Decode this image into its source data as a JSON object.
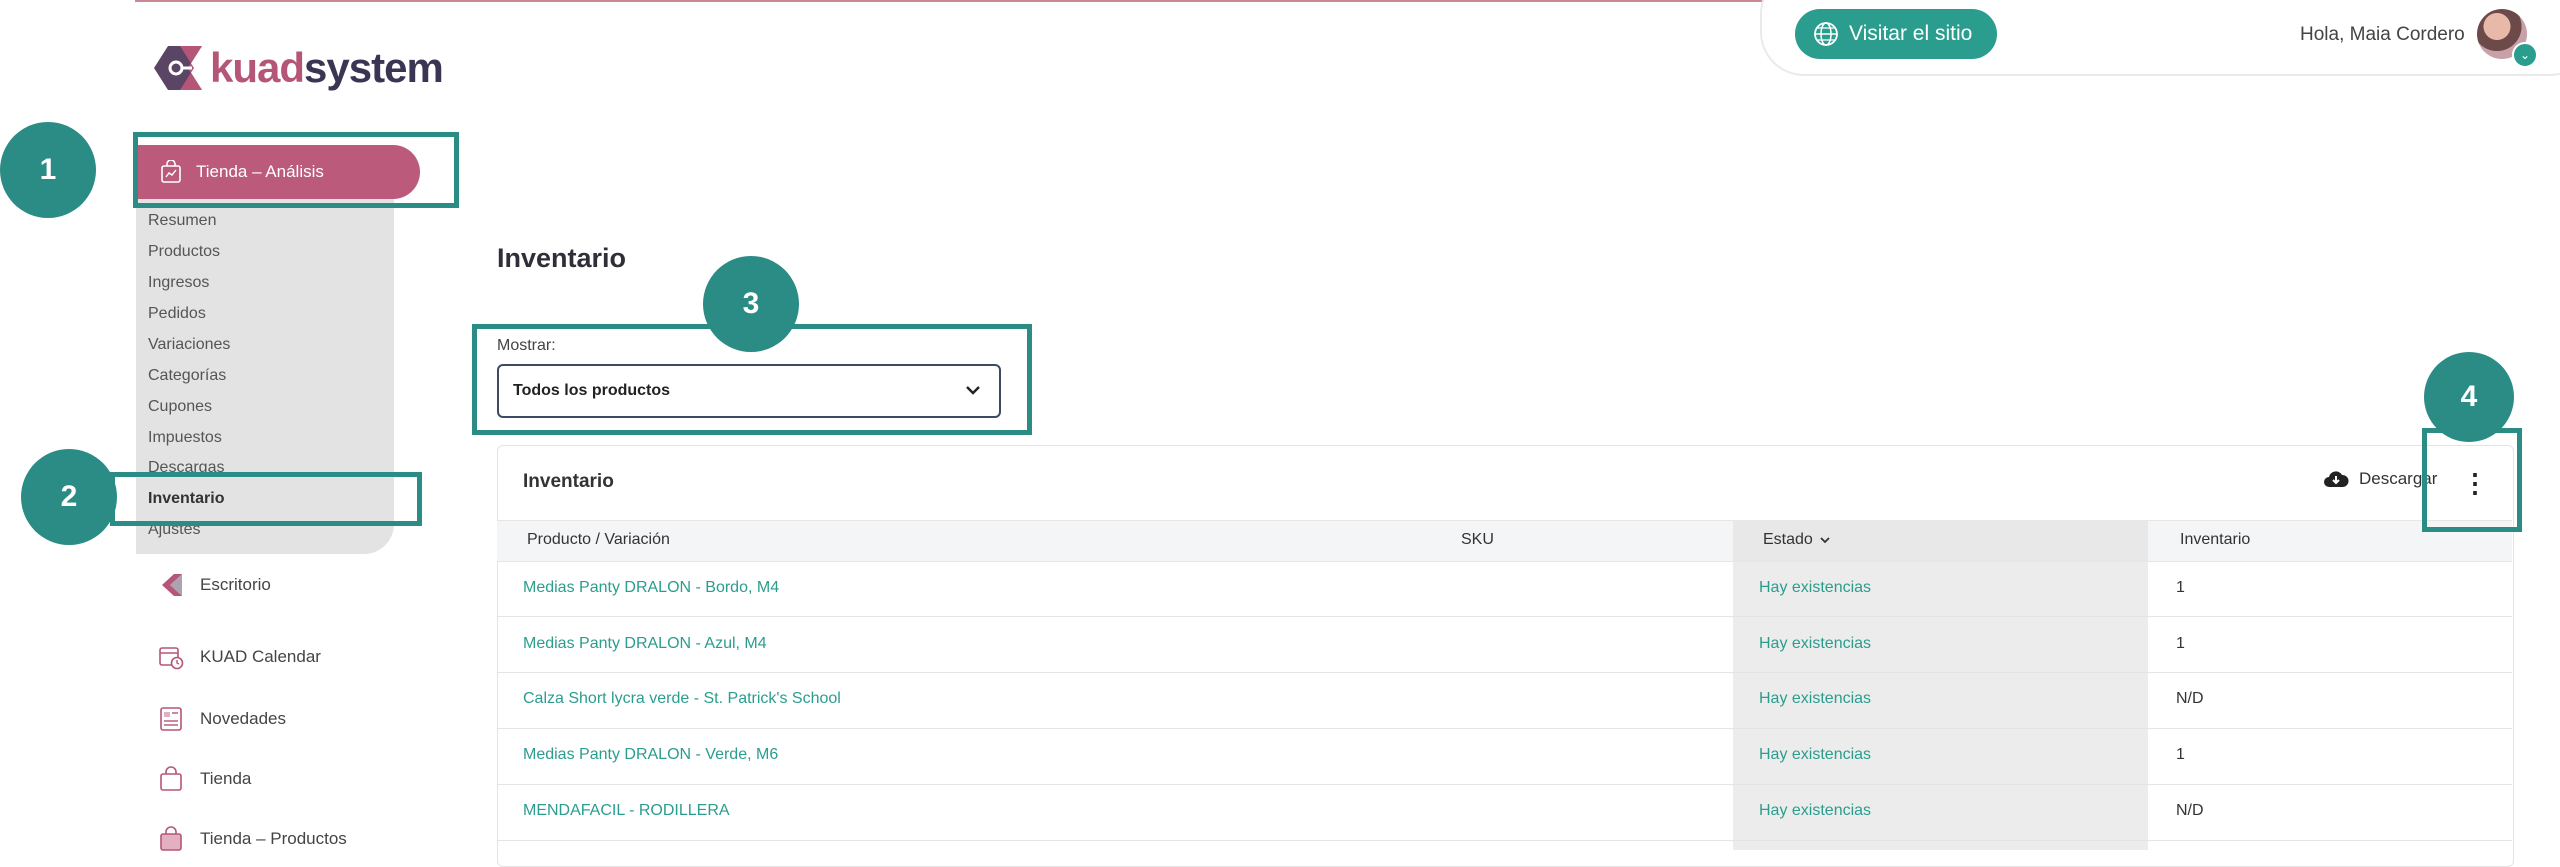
{
  "brand": {
    "kuad": "kuad",
    "system": "system"
  },
  "header": {
    "visit_label": "Visitar el sitio",
    "greeting": "Hola, Maia Cordero"
  },
  "sidebar": {
    "active_section": "Tienda – Análisis",
    "subitems": [
      "Resumen",
      "Productos",
      "Ingresos",
      "Pedidos",
      "Variaciones",
      "Categorías",
      "Cupones",
      "Impuestos",
      "Descargas",
      "Inventario",
      "Ajustes"
    ],
    "active_subitem_index": 9,
    "nav": [
      "Escritorio",
      "KUAD Calendar",
      "Novedades",
      "Tienda",
      "Tienda – Productos"
    ]
  },
  "callouts": [
    "1",
    "2",
    "3",
    "4"
  ],
  "main": {
    "page_title": "Inventario",
    "filter_label": "Mostrar:",
    "filter_value": "Todos los productos",
    "card_title": "Inventario",
    "download_label": "Descargar",
    "columns": [
      "Producto / Variación",
      "SKU",
      "Estado",
      "Inventario"
    ],
    "rows": [
      {
        "product": "Medias Panty DRALON - Bordo, M4",
        "sku": "",
        "status": "Hay existencias",
        "stock": "1"
      },
      {
        "product": "Medias Panty DRALON - Azul, M4",
        "sku": "",
        "status": "Hay existencias",
        "stock": "1"
      },
      {
        "product": "Calza Short lycra verde - St. Patrick's School",
        "sku": "",
        "status": "Hay existencias",
        "stock": "N/D"
      },
      {
        "product": "Medias Panty DRALON - Verde, M6",
        "sku": "",
        "status": "Hay existencias",
        "stock": "1"
      },
      {
        "product": "MENDAFACIL - RODILLERA",
        "sku": "",
        "status": "Hay existencias",
        "stock": "N/D"
      }
    ]
  },
  "colors": {
    "accent": "#2a9d8f",
    "brand_pink": "#bb5a7b",
    "callout": "#2b8c86"
  }
}
